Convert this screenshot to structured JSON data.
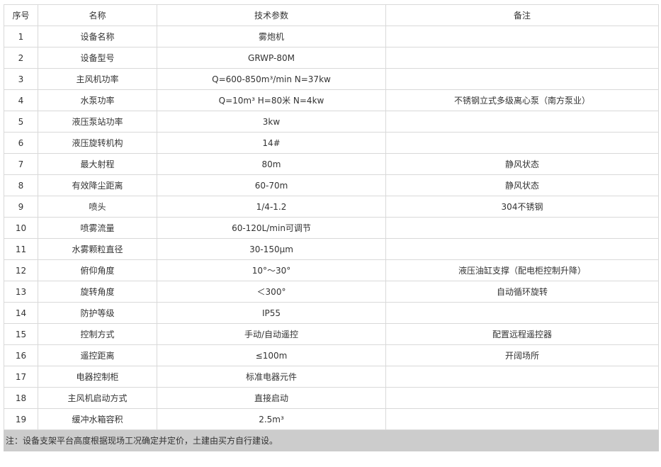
{
  "table": {
    "headers": [
      "序号",
      "名称",
      "技术参数",
      "备注"
    ],
    "rows": [
      {
        "no": "1",
        "name": "设备名称",
        "param": "雾炮机",
        "remark": ""
      },
      {
        "no": "2",
        "name": "设备型号",
        "param": "GRWP-80M",
        "remark": ""
      },
      {
        "no": "3",
        "name": "主风机功率",
        "param": "Q=600-850m³/min N=37kw",
        "remark": ""
      },
      {
        "no": "4",
        "name": "水泵功率",
        "param": "Q=10m³ H=80米 N=4kw",
        "remark": "不锈钢立式多级离心泵（南方泵业）"
      },
      {
        "no": "5",
        "name": "液压泵站功率",
        "param": "3kw",
        "remark": ""
      },
      {
        "no": "6",
        "name": "液压旋转机构",
        "param": "14#",
        "remark": ""
      },
      {
        "no": "7",
        "name": "最大射程",
        "param": "80m",
        "remark": "静风状态"
      },
      {
        "no": "8",
        "name": "有效降尘距离",
        "param": "60-70m",
        "remark": "静风状态"
      },
      {
        "no": "9",
        "name": "喷头",
        "param": "1/4-1.2",
        "remark": "304不锈钢"
      },
      {
        "no": "10",
        "name": "喷雾流量",
        "param": "60-120L/min可调节",
        "remark": ""
      },
      {
        "no": "11",
        "name": "水雾颗粒直径",
        "param": "30-150μm",
        "remark": ""
      },
      {
        "no": "12",
        "name": "俯仰角度",
        "param": "10°～30°",
        "remark": "液压油缸支撑（配电柜控制升降）"
      },
      {
        "no": "13",
        "name": "旋转角度",
        "param": "＜300°",
        "remark": "自动循环旋转"
      },
      {
        "no": "14",
        "name": "防护等级",
        "param": "IP55",
        "remark": ""
      },
      {
        "no": "15",
        "name": "控制方式",
        "param": "手动/自动遥控",
        "remark": "配置远程遥控器"
      },
      {
        "no": "16",
        "name": "遥控距离",
        "param": "≤100m",
        "remark": "开阔场所"
      },
      {
        "no": "17",
        "name": "电器控制柜",
        "param": "标准电器元件",
        "remark": ""
      },
      {
        "no": "18",
        "name": "主风机启动方式",
        "param": "直接启动",
        "remark": ""
      },
      {
        "no": "19",
        "name": "缓冲水箱容积",
        "param": "2.5m³",
        "remark": ""
      }
    ],
    "note": "注：设备支架平台高度根据现场工况确定并定价，土建由买方自行建设。"
  }
}
